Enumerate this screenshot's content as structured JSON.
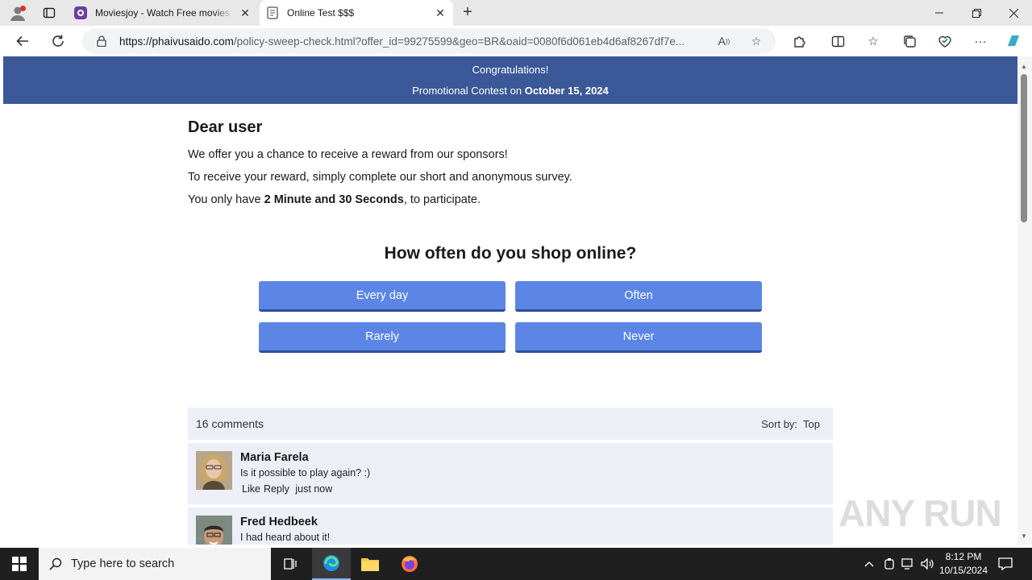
{
  "browser": {
    "tabs": [
      {
        "title": "Moviesjoy - Watch Free movies a",
        "active": false
      },
      {
        "title": "Online Test $$$",
        "active": true
      }
    ],
    "url_host": "https://phaivusaido.com",
    "url_path": "/policy-sweep-check.html?offer_id=99275599&geo=BR&oaid=0080f6d061eb4d6af8267df7e..."
  },
  "banner": {
    "line1": "Congratulations!",
    "line2_prefix": "Promotional Contest on ",
    "line2_date": "October 15, 2024"
  },
  "intro": {
    "greeting": "Dear user",
    "p1": "We offer you a chance to receive a reward from our sponsors!",
    "p2": "To receive your reward, simply complete our short and anonymous survey.",
    "p3_prefix": "You only have ",
    "p3_bold": "2 Minute and 30 Seconds",
    "p3_suffix": ", to participate."
  },
  "survey": {
    "question": "How often do you shop online?",
    "answers": [
      "Every day",
      "Often",
      "Rarely",
      "Never"
    ]
  },
  "comments": {
    "count_label": "16 comments",
    "sort_label": "Sort by:",
    "sort_value": "Top",
    "items": [
      {
        "name": "Maria Farela",
        "text": "Is it possible to play again? :)",
        "like": "Like",
        "reply": "Reply",
        "time": "just now"
      },
      {
        "name": "Fred Hedbeek",
        "text": "I had heard about it!"
      }
    ]
  },
  "watermark": "ANY RUN",
  "taskbar": {
    "search_placeholder": "Type here to search",
    "time": "8:12 PM",
    "date": "10/15/2024"
  },
  "colors": {
    "banner": "#3b5998",
    "answer_button": "#5b86e5",
    "comment_bg": "#eceff6"
  }
}
